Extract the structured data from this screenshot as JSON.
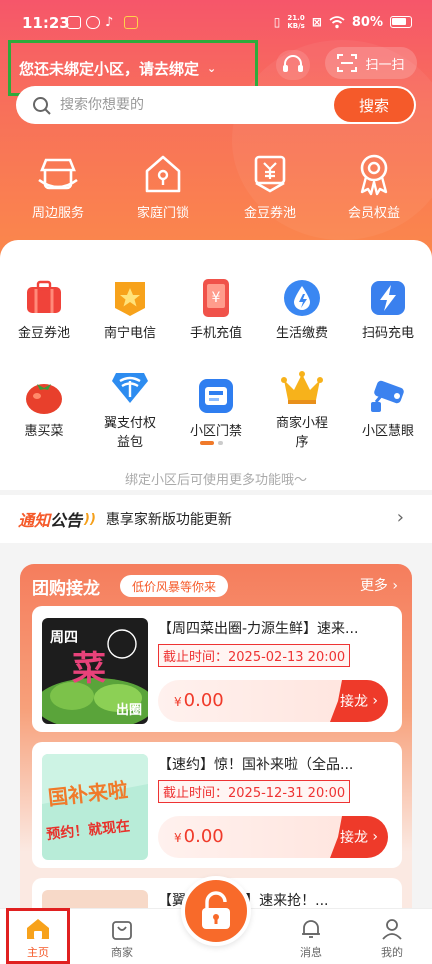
{
  "status": {
    "time": "11:23",
    "net_speed_value": "21.0",
    "net_speed_unit": "KB/s",
    "battery": "80%"
  },
  "header": {
    "community_prompt": "您还未绑定小区，请去绑定",
    "scan_label": "扫一扫"
  },
  "search": {
    "placeholder": "搜索你想要的",
    "button": "搜索"
  },
  "quick_actions": [
    {
      "label": "周边服务",
      "icon": "shop-icon"
    },
    {
      "label": "家庭门锁",
      "icon": "home-lock-icon"
    },
    {
      "label": "金豆券池",
      "icon": "coupon-icon"
    },
    {
      "label": "会员权益",
      "icon": "medal-icon"
    }
  ],
  "services": [
    {
      "label": "金豆券池",
      "icon": "suitcase-icon"
    },
    {
      "label": "南宁电信",
      "icon": "telecom-icon"
    },
    {
      "label": "手机充值",
      "icon": "phone-recharge-icon"
    },
    {
      "label": "生活缴费",
      "icon": "water-drop-icon"
    },
    {
      "label": "扫码充电",
      "icon": "charge-icon"
    },
    {
      "label": "惠买菜",
      "icon": "tomato-icon"
    },
    {
      "label": "翼支付权",
      "label2": "益包",
      "icon": "telecom-pay-icon"
    },
    {
      "label": "小区门禁",
      "icon": "access-card-icon"
    },
    {
      "label": "商家小程",
      "label2": "序",
      "icon": "crown-icon"
    },
    {
      "label": "小区慧眼",
      "icon": "camera-icon"
    }
  ],
  "bind_hint": "绑定小区后可使用更多功能哦～",
  "notice": {
    "logo_a": "通知",
    "logo_b": "公告",
    "text": "惠享家新版功能更新"
  },
  "group_buy": {
    "title": "团购接龙",
    "tag": "低价风暴等你来",
    "more": "更多",
    "items": [
      {
        "title": "【周四菜出圈-力源生鲜】速来...",
        "deadline": "截止时间：2025-02-13 20:00",
        "currency": "¥",
        "price": "0.00",
        "button": "接龙",
        "img_text1": "周四",
        "img_text2": "菜",
        "img_text3": "出圈"
      },
      {
        "title": "【速约】惊！国补来啦（全品...",
        "deadline": "截止时间：2025-12-31 20:00",
        "currency": "¥",
        "price": "0.00",
        "button": "接龙",
        "img_text1": "国补来啦",
        "img_text2": "预约！就现在"
      },
      {
        "title": "【翼...  ...攻略】速来抢！..."
      }
    ]
  },
  "tabbar": [
    {
      "label": "主页",
      "active": true
    },
    {
      "label": "商家"
    },
    {
      "label": "消息"
    },
    {
      "label": "我的"
    }
  ],
  "colors": {
    "accent": "#f55a2a",
    "header_top": "#f6566a",
    "header_bottom": "#fb8a4a",
    "deadline_red": "#e33333",
    "highlight_green": "#2eaa3b",
    "highlight_red": "#e02020"
  }
}
